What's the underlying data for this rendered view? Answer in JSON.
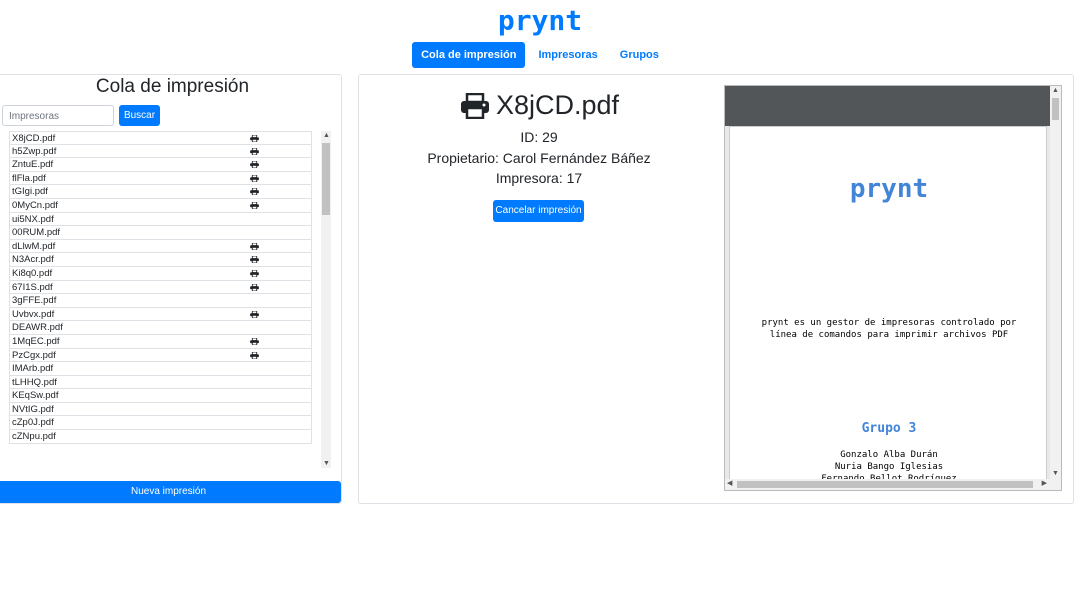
{
  "brand": "prynt",
  "nav": {
    "cola": "Cola de impresión",
    "impresoras": "Impresoras",
    "grupos": "Grupos"
  },
  "queue": {
    "title": "Cola de impresión",
    "search_placeholder": "Impresoras",
    "search_button": "Buscar",
    "items": [
      {
        "name": "X8jCD.pdf",
        "printer": true
      },
      {
        "name": "h5Zwp.pdf",
        "printer": true
      },
      {
        "name": "ZntuE.pdf",
        "printer": true
      },
      {
        "name": "flFla.pdf",
        "printer": true
      },
      {
        "name": "tGIgi.pdf",
        "printer": true
      },
      {
        "name": "0MyCn.pdf",
        "printer": true
      },
      {
        "name": "ui5NX.pdf",
        "printer": false
      },
      {
        "name": "00RUM.pdf",
        "printer": false
      },
      {
        "name": "dLlwM.pdf",
        "printer": true
      },
      {
        "name": "N3Acr.pdf",
        "printer": true
      },
      {
        "name": "Ki8q0.pdf",
        "printer": true
      },
      {
        "name": "67I1S.pdf",
        "printer": true
      },
      {
        "name": "3gFFE.pdf",
        "printer": false
      },
      {
        "name": "Uvbvx.pdf",
        "printer": true
      },
      {
        "name": "DEAWR.pdf",
        "printer": false
      },
      {
        "name": "1MqEC.pdf",
        "printer": true
      },
      {
        "name": "PzCgx.pdf",
        "printer": true
      },
      {
        "name": "IMArb.pdf",
        "printer": false
      },
      {
        "name": "tLHHQ.pdf",
        "printer": false
      },
      {
        "name": "KEqSw.pdf",
        "printer": false
      },
      {
        "name": "NVtIG.pdf",
        "printer": false
      },
      {
        "name": "cZp0J.pdf",
        "printer": false
      },
      {
        "name": "cZNpu.pdf",
        "printer": false
      }
    ],
    "new_button": "Nueva impresión"
  },
  "detail": {
    "filename": "X8jCD.pdf",
    "id_line": "ID: 29",
    "owner_line": "Propietario: Carol Fernández Báñez",
    "printer_line": "Impresora: 17",
    "cancel_button": "Cancelar impresión"
  },
  "pdf": {
    "brand": "prynt",
    "desc_line1": "prynt es un gestor de impresoras controlado por",
    "desc_line2": "línea de comandos para imprimir archivos PDF",
    "group": "Grupo 3",
    "member1": "Gonzalo Alba Durán",
    "member2": "Nuria Bango Iglesias",
    "member3": "Fernando Bellot Rodríguez"
  },
  "colors": {
    "primary": "#007bff",
    "pdf_accent": "#4285d8",
    "pdf_toolbar": "#525659"
  }
}
